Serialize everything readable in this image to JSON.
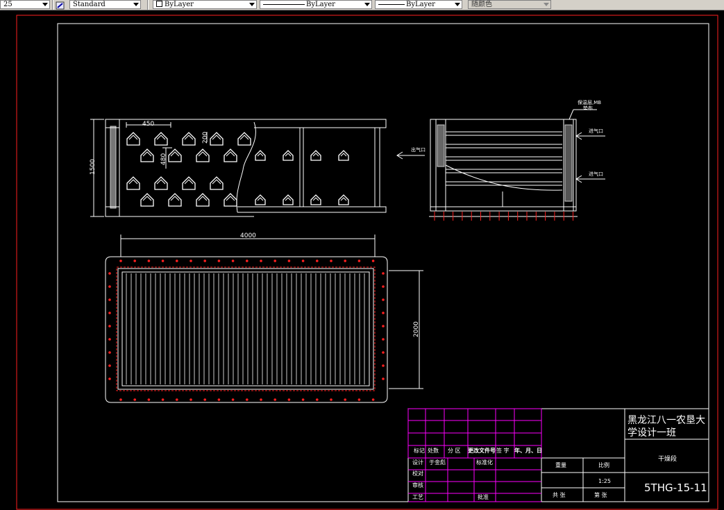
{
  "toolbar": {
    "scale_value": "25",
    "text_style": "Standard",
    "layer": "ByLayer",
    "linetype": "ByLayer",
    "lineweight": "ByLayer",
    "plot_style": "随颜色"
  },
  "drawing": {
    "dims": {
      "spacing_h": "450",
      "spacing_v1": "200",
      "spacing_v2": "480",
      "height": "1500",
      "length": "4000",
      "width": "2000"
    },
    "side_labels": {
      "outlet": "出气口",
      "inlet_top": "进气口",
      "inlet_bottom": "进气口",
      "part_line1": "保温层,MB",
      "part_line2": "垫布"
    },
    "title_block": {
      "school": "黑龙江八一农垦大学设计一班",
      "school_line1": "黑龙江八一农垦大",
      "school_line2": "学设计一班",
      "part_name": "干燥段",
      "drawing_no": "5THG-15-11",
      "weight_label": "重量",
      "ratio_label": "比例",
      "ratio_value": "1:25",
      "total_label": "共 张",
      "sheet_label": "第 张",
      "rev_headers": [
        "标记",
        "处数",
        "分 区",
        "更改文件号",
        "签 字",
        "年、月、日"
      ],
      "designer_label": "设计",
      "designer_name": "于金彪",
      "standard_label": "标准化",
      "check_label": "校对",
      "review_label": "审核",
      "process_label": "工艺",
      "approve_label": "批准"
    }
  },
  "colors": {
    "background": "#000000",
    "lines": "#ffffff",
    "border": "#ff0000",
    "table": "#ff00ff",
    "bolt": "#ff2020"
  }
}
